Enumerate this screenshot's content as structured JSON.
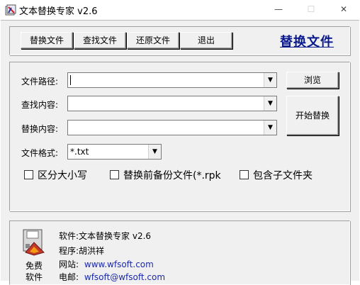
{
  "window": {
    "title": "文本替换专家 v2.6",
    "min_symbol": "—",
    "max_symbol": "☐",
    "close_symbol": "✕"
  },
  "toolbar": {
    "buttons": [
      "替换文件",
      "查找文件",
      "还原文件",
      "退出"
    ],
    "heading": "替换文件"
  },
  "form": {
    "path_label": "文件路径:",
    "path_value": "",
    "find_label": "查找内容:",
    "find_value": "",
    "replace_label": "替换内容:",
    "replace_value": "",
    "format_label": "文件格式:",
    "format_value": "*.txt",
    "browse_label": "浏览",
    "start_label": "开始替换",
    "options": [
      {
        "label": "区分大小写",
        "checked": false
      },
      {
        "label": "替换前备份文件(*.rpk",
        "checked": false
      },
      {
        "label": "包含子文件夹",
        "checked": false
      }
    ]
  },
  "about": {
    "icon": "disk-icon",
    "free_line1": "免费",
    "free_line2": "软件",
    "software": "软件:文本替换专家 v2.6",
    "author": "程序:胡洪祥",
    "site_label": "网站:",
    "site": "www.wfsoft.com",
    "email_label": "电邮:",
    "email": "wfsoft@wfsoft.com"
  },
  "colors": {
    "heading": "#0a1a8c",
    "link": "#1c2aa8",
    "face": "#f0f0f0"
  }
}
